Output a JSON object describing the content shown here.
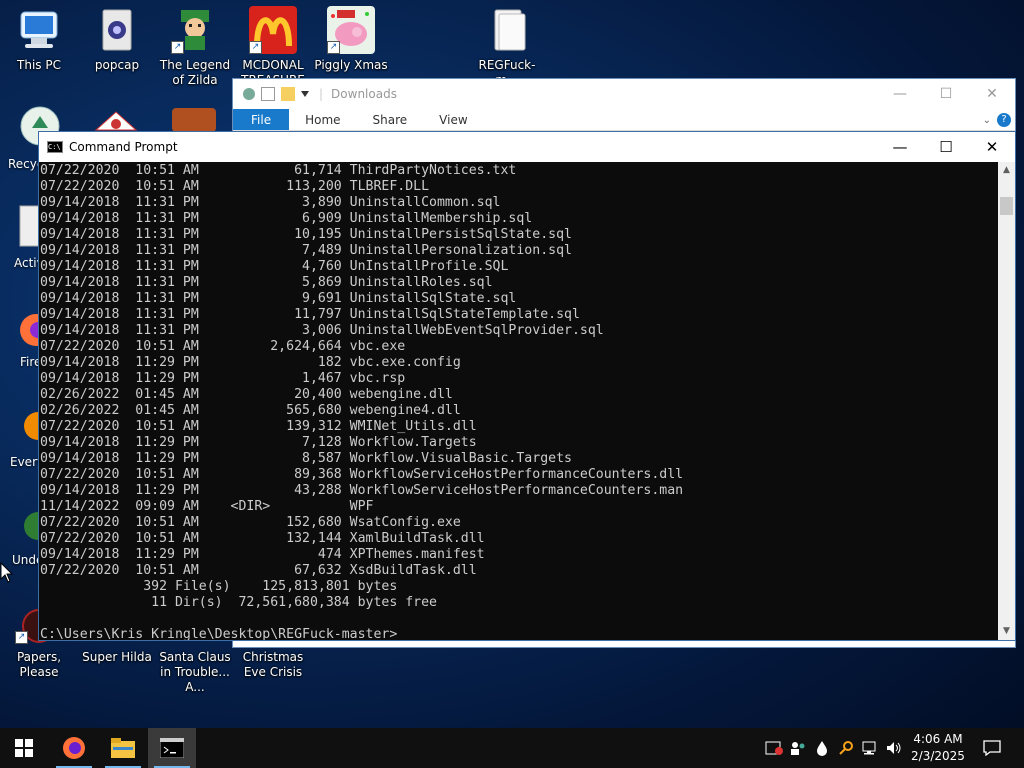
{
  "desktop": {
    "icons": [
      {
        "label": "This PC"
      },
      {
        "label": "popcap"
      },
      {
        "label": "The Legend of Zilda"
      },
      {
        "label": "MCDONAL TREASURE"
      },
      {
        "label": "Piggly Xmas"
      },
      {
        "label": "REGFuck-m..."
      },
      {
        "label": "Papers, Please"
      },
      {
        "label": "Super Hilda"
      },
      {
        "label": "Santa Claus in Trouble... A..."
      },
      {
        "label": "Christmas Eve Crisis"
      }
    ],
    "partial_labels": [
      "Recyc",
      "Activ",
      "Fire",
      "Every",
      "Unde"
    ]
  },
  "explorer": {
    "title": "Downloads",
    "tabs": [
      "File",
      "Home",
      "Share",
      "View"
    ],
    "help": "?",
    "controls": {
      "minimize": "—",
      "maximize": "☐",
      "close": "✕"
    }
  },
  "cmd": {
    "title": "Command Prompt",
    "controls": {
      "minimize": "—",
      "maximize": "☐",
      "close": "✕"
    },
    "lines": [
      "07/22/2020  10:51 AM            61,714 ThirdPartyNotices.txt",
      "07/22/2020  10:51 AM           113,200 TLBREF.DLL",
      "09/14/2018  11:31 PM             3,890 UninstallCommon.sql",
      "09/14/2018  11:31 PM             6,909 UninstallMembership.sql",
      "09/14/2018  11:31 PM            10,195 UninstallPersistSqlState.sql",
      "09/14/2018  11:31 PM             7,489 UninstallPersonalization.sql",
      "09/14/2018  11:31 PM             4,760 UnInstallProfile.SQL",
      "09/14/2018  11:31 PM             5,869 UninstallRoles.sql",
      "09/14/2018  11:31 PM             9,691 UninstallSqlState.sql",
      "09/14/2018  11:31 PM            11,797 UninstallSqlStateTemplate.sql",
      "09/14/2018  11:31 PM             3,006 UninstallWebEventSqlProvider.sql",
      "07/22/2020  10:51 AM         2,624,664 vbc.exe",
      "09/14/2018  11:29 PM               182 vbc.exe.config",
      "09/14/2018  11:29 PM             1,467 vbc.rsp",
      "02/26/2022  01:45 AM            20,400 webengine.dll",
      "02/26/2022  01:45 AM           565,680 webengine4.dll",
      "07/22/2020  10:51 AM           139,312 WMINet_Utils.dll",
      "09/14/2018  11:29 PM             7,128 Workflow.Targets",
      "09/14/2018  11:29 PM             8,587 Workflow.VisualBasic.Targets",
      "07/22/2020  10:51 AM            89,368 WorkflowServiceHostPerformanceCounters.dll",
      "09/14/2018  11:29 PM            43,288 WorkflowServiceHostPerformanceCounters.man",
      "11/14/2022  09:09 AM    <DIR>          WPF",
      "07/22/2020  10:51 AM           152,680 WsatConfig.exe",
      "07/22/2020  10:51 AM           132,144 XamlBuildTask.dll",
      "09/14/2018  11:29 PM               474 XPThemes.manifest",
      "07/22/2020  10:51 AM            67,632 XsdBuildTask.dll",
      "             392 File(s)    125,813,801 bytes",
      "              11 Dir(s)  72,561,680,384 bytes free",
      "",
      "C:\\Users\\Kris Kringle\\Desktop\\REGFuck-master>"
    ]
  },
  "taskbar": {
    "time": "4:06 AM",
    "date": "2/3/2025",
    "apps": [
      "start-button",
      "firefox",
      "file-explorer",
      "command-prompt"
    ],
    "active_app": "command-prompt"
  },
  "colors": {
    "console_bg": "#0c0c0c",
    "console_fg": "#cccccc",
    "ribbon_file": "#1979ca",
    "taskbar": "#101010",
    "accent": "#76b9ed"
  }
}
